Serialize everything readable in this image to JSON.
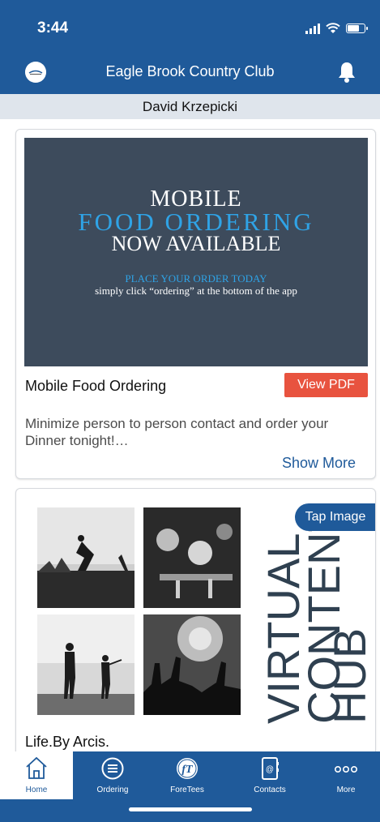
{
  "status": {
    "time": "3:44"
  },
  "header": {
    "title": "Eagle Brook Country Club"
  },
  "user": {
    "name": "David Krzepicki"
  },
  "card1": {
    "banner": {
      "line1": "MOBILE",
      "line2": "FOOD ORDERING",
      "line3": "NOW AVAILABLE",
      "line4": "PLACE YOUR ORDER TODAY",
      "line5": "simply click “ordering” at the bottom of the app"
    },
    "title": "Mobile Food Ordering",
    "pdf_button": "View PDF",
    "description": "Minimize person to person contact and order your Dinner tonight!…",
    "show_more": "Show More"
  },
  "card2": {
    "tap_badge": "Tap Image",
    "vertical_text": [
      "VIRTUAL",
      "CONTENT",
      "HUB"
    ],
    "title": "Life.By Arcis."
  },
  "tabs": [
    {
      "label": "Home",
      "icon": "home-icon"
    },
    {
      "label": "Ordering",
      "icon": "menu-lines-icon"
    },
    {
      "label": "ForeTees",
      "icon": "foretees-icon"
    },
    {
      "label": "Contacts",
      "icon": "contact-book-icon"
    },
    {
      "label": "More",
      "icon": "more-dots-icon"
    }
  ],
  "colors": {
    "brand": "#1f5a9a",
    "accent": "#e8533f",
    "banner": "#3d4b5c",
    "highlight": "#2fa3e6"
  }
}
